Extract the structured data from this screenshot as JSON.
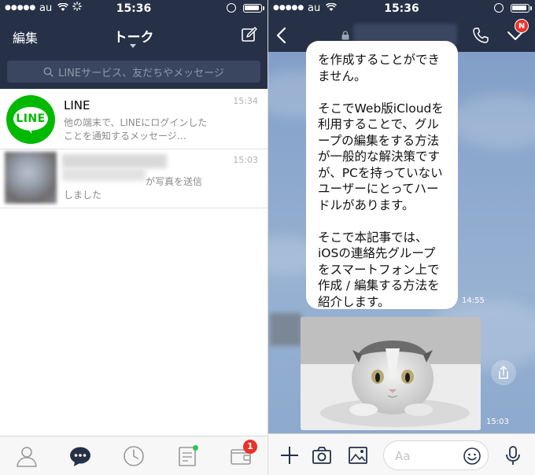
{
  "status_bar": {
    "carrier": "au",
    "time": "15:36"
  },
  "left": {
    "header": {
      "edit_label": "編集",
      "title": "トーク",
      "compose_icon": "compose-icon"
    },
    "search": {
      "placeholder": "LINEサービス、友だちやメッセージ"
    },
    "chats": [
      {
        "name": "LINE",
        "time": "15:34",
        "preview": "他の端末で、LINEにログインしたことを通知するメッセージ…"
      },
      {
        "name": "",
        "time": "15:03",
        "preview_line1": "が写真を送信",
        "preview_line2": "しました"
      }
    ],
    "tabbar": {
      "items": [
        "friends-icon",
        "chats-icon",
        "timeline-icon",
        "news-icon",
        "wallet-icon"
      ],
      "wallet_badge": "1"
    }
  },
  "right": {
    "header": {
      "notification_badge": "N"
    },
    "message": {
      "lines": [
        "を作成することができ",
        "ません。",
        "",
        "そこでWeb版iCloudを",
        "利用することで、グル",
        "ープの編集をする方法",
        "が一般的な解決策です",
        "が、PCを持っていない",
        "ユーザーにとってハー",
        "ドルがあります。",
        "",
        "そこで本記事では、",
        "iOSの連絡先グループ",
        "をスマートフォン上で",
        "作成 / 編集する方法を",
        "紹介します。"
      ],
      "time": "14:55"
    },
    "photo": {
      "time": "15:03"
    },
    "input": {
      "placeholder": "Aa"
    }
  },
  "colors": {
    "header_bg": "#263147",
    "line_green": "#00b900",
    "badge_red": "#e8322b"
  }
}
